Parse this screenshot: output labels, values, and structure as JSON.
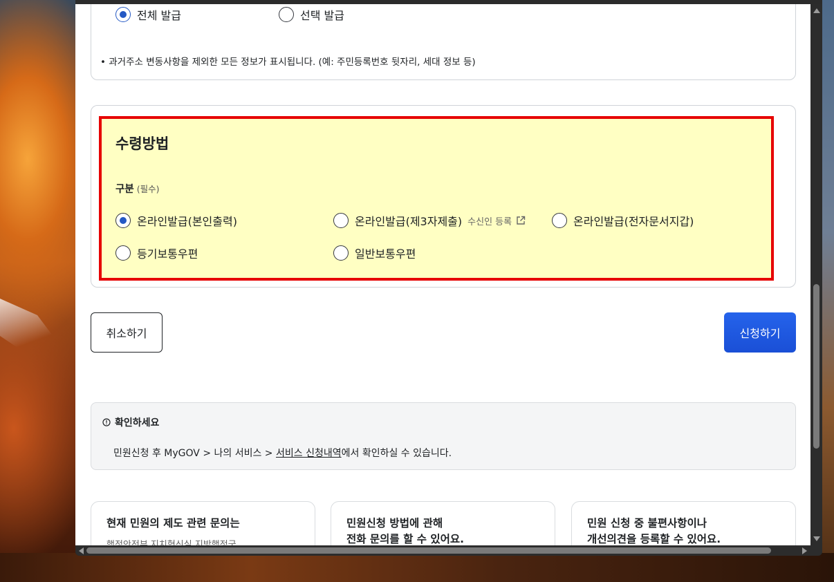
{
  "issue_scope": {
    "options": [
      "전체 발급",
      "선택 발급"
    ],
    "selected": "전체 발급",
    "note": "• 과거주소 변동사항을 제외한 모든 정보가 표시됩니다. (예: 주민등록번호 뒷자리, 세대 정보 등)"
  },
  "receive_method": {
    "title": "수령방법",
    "field_label": "구분",
    "required_label": "(필수)",
    "options": [
      "온라인발급(본인출력)",
      "온라인발급(제3자제출)",
      "온라인발급(전자문서지갑)",
      "등기보통우편",
      "일반보통우편"
    ],
    "selected": "온라인발급(본인출력)",
    "recipient_register_link": "수신인 등록",
    "highlight_color": "#e60000"
  },
  "actions": {
    "cancel_label": "취소하기",
    "submit_label": "신청하기",
    "submit_color": "#1d4ed8"
  },
  "notice": {
    "title": "확인하세요",
    "text_before": "민원신청 후 MyGOV > 나의 서비스 > ",
    "link_text": "서비스 신청내역",
    "text_after": "에서 확인하실 수 있습니다."
  },
  "contacts": [
    {
      "line1": "현재 민원의 제도 관련 문의는",
      "line2": "",
      "sub": "행정안전부 지치혁신실 지방행정국"
    },
    {
      "line1": "민원신청 방법에 관해",
      "line2": "전화 문의를 할 수 있어요.",
      "sub": ""
    },
    {
      "line1": "민원 신청 중 불편사항이나",
      "line2": "개선의견을 등록할 수 있어요.",
      "sub": ""
    }
  ]
}
